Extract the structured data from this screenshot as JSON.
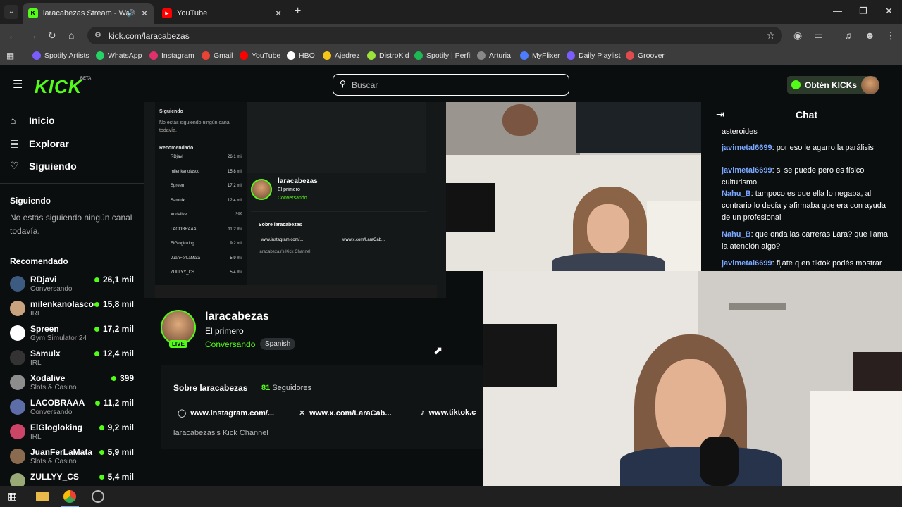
{
  "browser": {
    "tabs": [
      {
        "title": "laracabezas Stream - Watch",
        "active": true
      },
      {
        "title": "YouTube",
        "active": false
      }
    ],
    "url": "kick.com/laracabezas",
    "bookmarks": [
      "Spotify Artists",
      "WhatsApp",
      "Instagram",
      "Gmail",
      "YouTube",
      "HBO",
      "Ajedrez",
      "DistroKid",
      "Spotify | Perfil",
      "Arturia",
      "MyFlixer",
      "Daily Playlist",
      "Groover"
    ],
    "bookmark_colors": [
      "#7b5cff",
      "#25d366",
      "#e1306c",
      "#ea4335",
      "#ff0000",
      "#ffffff",
      "#f5c518",
      "#9be53a",
      "#1db954",
      "#888888",
      "#4e7cff",
      "#7b5cff",
      "#e14b4b"
    ]
  },
  "header": {
    "logo": "KICK",
    "beta": "BETA",
    "search_placeholder": "Buscar",
    "kicks_button": "Obtén KICKs"
  },
  "sidebar": {
    "nav": [
      "Inicio",
      "Explorar",
      "Siguiendo"
    ],
    "following_title": "Siguiendo",
    "following_empty": "No estás siguiendo ningún canal todavía.",
    "recommended_title": "Recomendado",
    "recommended": [
      {
        "name": "RDjavi",
        "category": "Conversando",
        "viewers": "26,1 mil"
      },
      {
        "name": "milenkanolasco",
        "category": "IRL",
        "viewers": "15,8 mil"
      },
      {
        "name": "Spreen",
        "category": "Gym Simulator 24",
        "viewers": "17,2 mil"
      },
      {
        "name": "Samulx",
        "category": "IRL",
        "viewers": "12,4 mil"
      },
      {
        "name": "Xodalive",
        "category": "Slots & Casino",
        "viewers": "399"
      },
      {
        "name": "LACOBRAAA",
        "category": "Conversando",
        "viewers": "11,2 mil"
      },
      {
        "name": "ElGlogloking",
        "category": "IRL",
        "viewers": "9,2 mil"
      },
      {
        "name": "JuanFerLaMata",
        "category": "Slots & Casino",
        "viewers": "5,9 mil"
      },
      {
        "name": "ZULLYY_CS",
        "category": "",
        "viewers": "5,4 mil"
      }
    ]
  },
  "channel": {
    "name": "laracabezas",
    "title": "El primero",
    "category": "Conversando",
    "language": "Spanish",
    "live_badge": "LIVE",
    "about_label": "Sobre laracabezas",
    "followers_count": "81",
    "followers_label": "Seguidores",
    "links": [
      "www.instagram.com/...",
      "www.x.com/LaraCab...",
      "www.tiktok.c"
    ],
    "description": "laracabezas's Kick Channel"
  },
  "chat": {
    "title": "Chat",
    "messages": [
      {
        "user": "",
        "text": "asteroides"
      },
      {
        "user": "javimetal6699",
        "text": "por eso le agarro la parálisis"
      },
      {
        "user": "javimetal6699",
        "text": "si se puede pero es físico culturismo"
      },
      {
        "user": "Nahu_B",
        "text": "tampoco es que ella lo negaba, al contrario lo decía y afirmaba que era con ayuda de un profesional"
      },
      {
        "user": "Nahu_B",
        "text": "que onda las carreras Lara? que llama la atención algo?"
      },
      {
        "user": "javimetal6699",
        "text": "fijate q en tiktok podés mostrar"
      }
    ],
    "user_colors": {
      "javimetal6699": "#7aa7ff",
      "Nahu_B": "#7aa7ff"
    }
  },
  "nested_preview": {
    "following": "Siguiendo",
    "empty": "No estás siguiendo ningún canal todavía.",
    "recommended": "Recomendado"
  }
}
